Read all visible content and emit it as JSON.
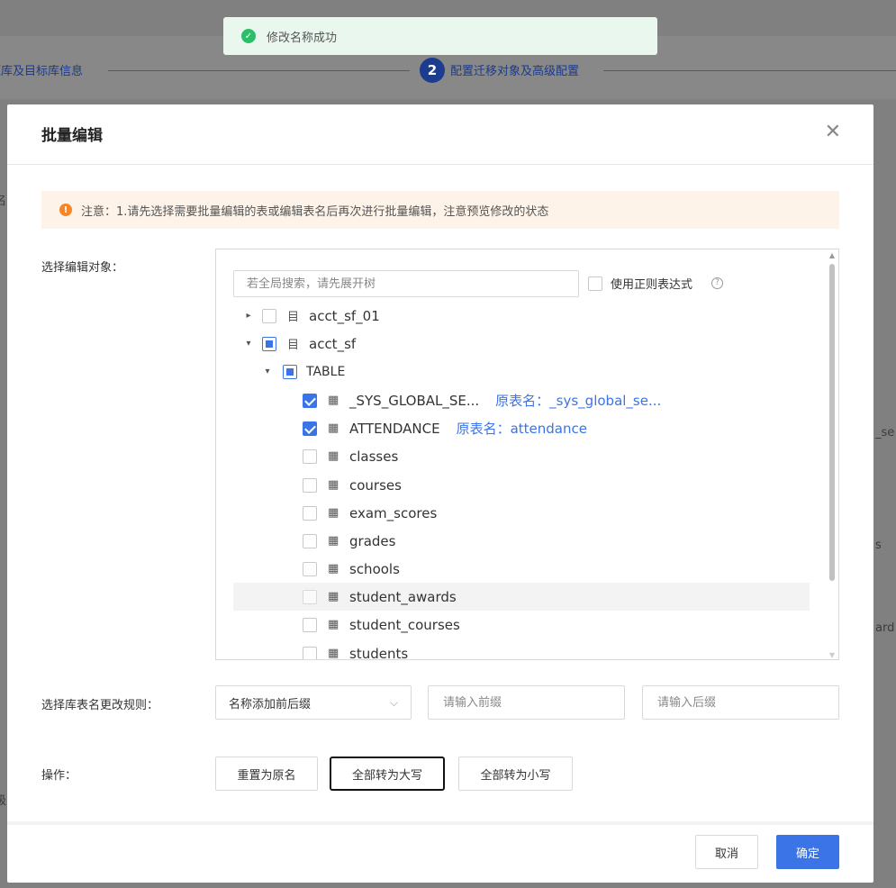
{
  "toast": {
    "text": "修改名称成功",
    "icon": "check-circle-icon"
  },
  "background": {
    "step1_label": "源库及目标库信息",
    "step2_number": "2",
    "step2_label": "配置迁移对象及高级配置",
    "frag_sys": "_se",
    "frag_s": "s",
    "frag_ard": "ard",
    "frag_left1": "名",
    "frag_left2": "级"
  },
  "modal": {
    "title": "批量编辑",
    "close_icon": "close-icon",
    "notice": "注意：1.请先选择需要批量编辑的表或编辑表名后再次进行批量编辑，注意预览修改的状态",
    "select_label": "选择编辑对象：",
    "search_placeholder": "若全局搜索，请先展开树",
    "regex_label": "使用正则表达式",
    "help_icon_glyph": "?",
    "tree": {
      "db1": {
        "caret": "▸",
        "label": "acct_sf_01",
        "checked": false
      },
      "db2": {
        "caret": "▾",
        "label": "acct_sf",
        "state": "indeterminate"
      },
      "group": {
        "caret": "▾",
        "label": "TABLE",
        "state": "indeterminate"
      },
      "tables": [
        {
          "label": "_SYS_GLOBAL_SE...",
          "orig": "原表名：_sys_global_se...",
          "checked": true
        },
        {
          "label": "ATTENDANCE",
          "orig": "原表名：attendance",
          "checked": true
        },
        {
          "label": "classes",
          "checked": false
        },
        {
          "label": "courses",
          "checked": false
        },
        {
          "label": "exam_scores",
          "checked": false
        },
        {
          "label": "grades",
          "checked": false
        },
        {
          "label": "schools",
          "checked": false
        },
        {
          "label": "student_awards",
          "checked": false,
          "hovered": true
        },
        {
          "label": "student_courses",
          "checked": false
        },
        {
          "label": "students",
          "checked": false
        }
      ]
    },
    "rule_label": "选择库表名更改规则：",
    "rule_select": "名称添加前后缀",
    "prefix_placeholder": "请输入前缀",
    "suffix_placeholder": "请输入后缀",
    "op_label": "操作：",
    "ops": {
      "reset": "重置为原名",
      "upper": "全部转为大写",
      "lower": "全部转为小写"
    },
    "cancel": "取消",
    "ok": "确定"
  },
  "colors": {
    "primary": "#3b74e6",
    "success": "#2cbf6a",
    "warning": "#f5862a"
  }
}
